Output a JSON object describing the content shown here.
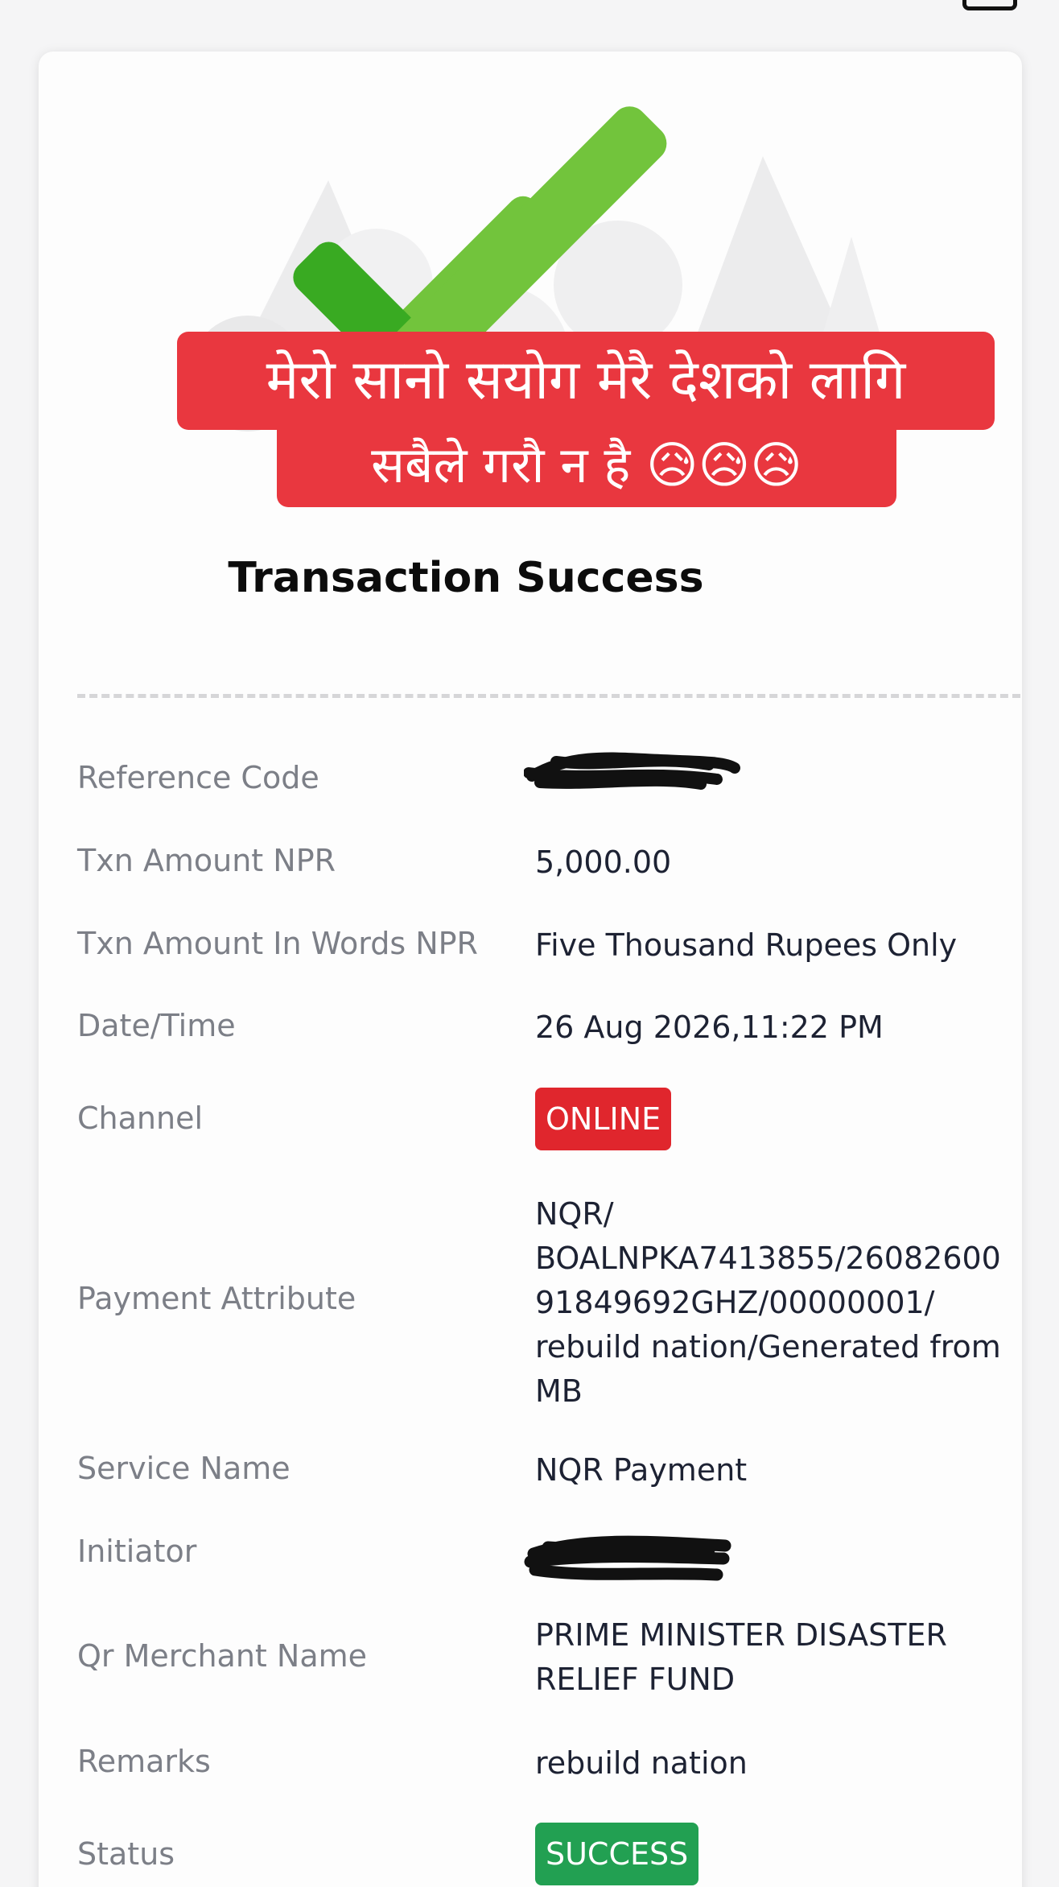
{
  "colors": {
    "banner_red": "#e9373f",
    "check_dark": "#39aa22",
    "check_light": "#72c43c",
    "channel_red": "#e0262d",
    "status_green": "#22a052",
    "label_gray": "#7c7f87",
    "value_dark": "#1d2233"
  },
  "hero": {
    "icon": "success-checkmark-icon",
    "banner_line1": "मेरो सानो सयोग मेरै देशको लागि",
    "banner_line2": "सबैले गरौ न है 😥😥😥",
    "title": "Transaction Success"
  },
  "details": {
    "reference_code_label": "Reference Code",
    "reference_code_value": "",
    "txn_amount_label": "Txn Amount NPR",
    "txn_amount_value": "5,000.00",
    "txn_words_label": "Txn Amount In Words NPR",
    "txn_words_value": "Five Thousand Rupees Only",
    "datetime_label": "Date/Time",
    "datetime_value": "26 Aug 2026,11:22 PM",
    "channel_label": "Channel",
    "channel_value": "ONLINE",
    "payment_attr_label": "Payment Attribute",
    "payment_attr_line1": "NQR/",
    "payment_attr_line2": "BOALNPKA7413855/26082600",
    "payment_attr_line3": "91849692GHZ/00000001/",
    "payment_attr_line4": "rebuild nation/Generated from",
    "payment_attr_line5": "MB",
    "service_name_label": "Service Name",
    "service_name_value": "NQR Payment",
    "initiator_label": "Initiator",
    "initiator_value": "",
    "merchant_label": "Qr Merchant Name",
    "merchant_line1": "PRIME MINISTER DISASTER",
    "merchant_line2": "RELIEF FUND",
    "remarks_label": "Remarks",
    "remarks_value": "rebuild nation",
    "status_label": "Status",
    "status_value": "SUCCESS"
  }
}
